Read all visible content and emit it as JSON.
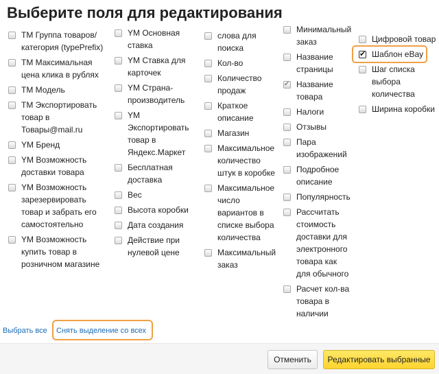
{
  "dialog": {
    "title": "Выберите поля для редактирования"
  },
  "columns": [
    [
      {
        "lines": [
          "ТМ Группа товаров/",
          "категория (typePrefix)"
        ],
        "checked": false
      },
      {
        "lines": [
          "ТМ Максимальная",
          "цена клика в рублях"
        ],
        "checked": false
      },
      {
        "lines": [
          "ТМ Модель"
        ],
        "checked": false
      },
      {
        "lines": [
          "ТМ Экспортировать",
          "товар в",
          "Товары@mail.ru"
        ],
        "checked": false
      },
      {
        "lines": [
          "YM Бренд"
        ],
        "checked": false
      },
      {
        "lines": [
          "YM Возможность",
          "доставки товара"
        ],
        "checked": false
      },
      {
        "lines": [
          "YM Возможность",
          "зарезервировать",
          "товар и забрать его",
          "самостоятельно"
        ],
        "checked": false
      },
      {
        "lines": [
          "YM Возможность",
          "купить товар в",
          "розничном магазине"
        ],
        "checked": false
      }
    ],
    [
      {
        "lines": [
          "YM Основная",
          "ставка"
        ],
        "checked": false
      },
      {
        "lines": [
          "YM Ставка для",
          "карточек"
        ],
        "checked": false
      },
      {
        "lines": [
          "YM Страна-",
          "производитель"
        ],
        "checked": false
      },
      {
        "lines": [
          "YM",
          "Экспортировать",
          "товар в",
          "Яндекс.Маркет"
        ],
        "checked": false
      },
      {
        "lines": [
          "Бесплатная",
          "доставка"
        ],
        "checked": false
      },
      {
        "lines": [
          "Вес"
        ],
        "checked": false
      },
      {
        "lines": [
          "Высота коробки"
        ],
        "checked": false
      },
      {
        "lines": [
          "Дата создания"
        ],
        "checked": false
      },
      {
        "lines": [
          "Действие при",
          "нулевой цене"
        ],
        "checked": false
      }
    ],
    [
      {
        "lines": [
          "слова для",
          "поиска"
        ],
        "checked": false
      },
      {
        "lines": [
          "Кол-во"
        ],
        "checked": false
      },
      {
        "lines": [
          "Количество",
          "продаж"
        ],
        "checked": false
      },
      {
        "lines": [
          "Краткое",
          "описание"
        ],
        "checked": false
      },
      {
        "lines": [
          "Магазин"
        ],
        "checked": false
      },
      {
        "lines": [
          "Максимальное",
          "количество",
          "штук в коробке"
        ],
        "checked": false
      },
      {
        "lines": [
          "Максимальное",
          "число",
          "вариантов в",
          "списке выбора",
          "количества"
        ],
        "checked": false
      },
      {
        "lines": [
          "Максимальный",
          "заказ"
        ],
        "checked": false
      }
    ],
    [
      {
        "lines": [
          "Минимальный",
          "заказ"
        ],
        "checked": false
      },
      {
        "lines": [
          "Название",
          "страницы"
        ],
        "checked": false
      },
      {
        "lines": [
          "Название",
          "товара"
        ],
        "checked": true
      },
      {
        "lines": [
          "Налоги"
        ],
        "checked": false
      },
      {
        "lines": [
          "Отзывы"
        ],
        "checked": false
      },
      {
        "lines": [
          "Пара",
          "изображений"
        ],
        "checked": false
      },
      {
        "lines": [
          "Подробное",
          "описание"
        ],
        "checked": false
      },
      {
        "lines": [
          "Популярность"
        ],
        "checked": false
      },
      {
        "lines": [
          "Рассчитать",
          "стоимость",
          "доставки для",
          "электронного",
          "товара как",
          "для обычного"
        ],
        "checked": false
      },
      {
        "lines": [
          "Расчет кол-ва",
          "товара в",
          "наличии"
        ],
        "checked": false
      }
    ],
    [
      {
        "lines": [
          "Цифровой товар"
        ],
        "checked": false
      },
      {
        "lines": [
          "Шаблон eBay"
        ],
        "checked": true
      },
      {
        "lines": [
          "Шаг списка",
          "выбора",
          "количества"
        ],
        "checked": false
      },
      {
        "lines": [
          "Ширина коробки"
        ],
        "checked": false
      }
    ]
  ],
  "links": {
    "select_all": "Выбрать все",
    "deselect_all": "Снять выделение со всех"
  },
  "buttons": {
    "cancel": "Отменить",
    "edit_selected": "Редактировать выбранные"
  },
  "colors": {
    "highlight": "#f0a046",
    "link": "#1b6ab5",
    "primary_button": "#ffd42e"
  }
}
